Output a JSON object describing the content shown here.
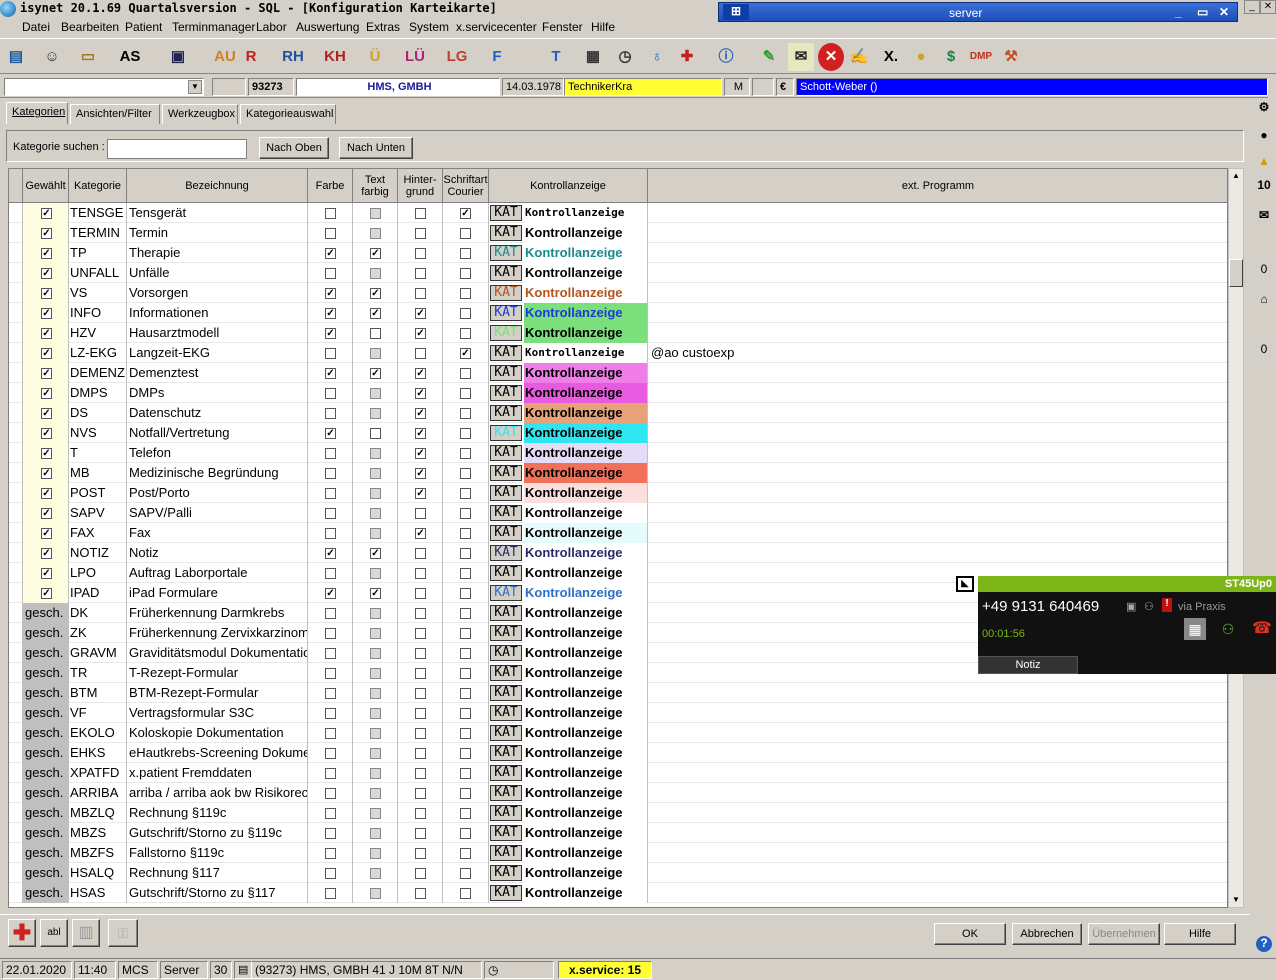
{
  "window": {
    "title": "isynet 20.1.69 Quartalsversion - SQL - [Konfiguration Karteikarte]"
  },
  "rdp": {
    "server": "server",
    "pin": "⊞",
    "min": "_",
    "restore": "▭",
    "close": "✕"
  },
  "menu": [
    "Datei",
    "Bearbeiten",
    "Patient",
    "Terminmanager",
    "Labor",
    "Auswertung",
    "Extras",
    "System",
    "x.servicecenter",
    "Fenster",
    "Hilfe"
  ],
  "toolbar": {
    "items": [
      "AS",
      "AU",
      "R",
      "RH",
      "KH",
      "Ü",
      "LÜ",
      "LG",
      "F",
      "X."
    ],
    "dmp": "DMP"
  },
  "patient": {
    "id": "93273",
    "name": "HMS, GMBH",
    "birth": "14.03.1978",
    "insurance": "TechnikerKra",
    "sex": "M",
    "currency": "€",
    "doctor": "Schott-Weber ()"
  },
  "tabs": [
    "Kategorien",
    "Ansichten/Filter",
    "Werkzeugbox",
    "Kategorieauswahl"
  ],
  "search": {
    "label": "Kategorie suchen :",
    "value": "",
    "up": "Nach Oben",
    "down": "Nach Unten"
  },
  "grid": {
    "headers": {
      "gewaehlt": "Gewählt",
      "kategorie": "Kategorie",
      "bezeichnung": "Bezeichnung",
      "farbe": "Farbe",
      "text_farbig": "Text farbig",
      "hintergrund": "Hinter- grund",
      "schriftart": "Schriftart Courier",
      "kontroll": "Kontrollanzeige",
      "ext": "ext. Programm"
    },
    "kat_label": "KAT",
    "rows": [
      {
        "sel": "check",
        "kat": "TENSGE",
        "bez": "Tensgerät",
        "f": 0,
        "t": 2,
        "h": 0,
        "s": 1,
        "katc": "#000",
        "kc": "#000",
        "kb": "#fff",
        "ctrl": "Kontrollanzeige",
        "ext": ""
      },
      {
        "sel": "check",
        "kat": "TERMIN",
        "bez": "Termin",
        "f": 0,
        "t": 2,
        "h": 0,
        "s": 0,
        "katc": "#000",
        "kc": "#000",
        "kb": "#fff",
        "ctrl": "Kontrollanzeige",
        "ext": ""
      },
      {
        "sel": "check",
        "kat": "TP",
        "bez": "Therapie",
        "f": 1,
        "t": 1,
        "h": 0,
        "s": 0,
        "katc": "#1a8a8a",
        "kc": "#1a8a8a",
        "kb": "#fff",
        "ctrl": "Kontrollanzeige",
        "ext": ""
      },
      {
        "sel": "check",
        "kat": "UNFALL",
        "bez": "Unfälle",
        "f": 0,
        "t": 2,
        "h": 0,
        "s": 0,
        "katc": "#000",
        "kc": "#000",
        "kb": "#fff",
        "ctrl": "Kontrollanzeige",
        "ext": ""
      },
      {
        "sel": "check",
        "kat": "VS",
        "bez": "Vorsorgen",
        "f": 1,
        "t": 1,
        "h": 0,
        "s": 0,
        "katc": "#b3541e",
        "kc": "#b3541e",
        "kb": "#fff",
        "ctrl": "Kontrollanzeige",
        "ext": ""
      },
      {
        "sel": "check",
        "kat": "INFO",
        "bez": "Informationen",
        "f": 1,
        "t": 1,
        "h": 1,
        "s": 0,
        "katc": "#1a3bd6",
        "kc": "#1a3bd6",
        "kb": "#7be07b",
        "ctrl": "Kontrollanzeige",
        "ext": ""
      },
      {
        "sel": "check",
        "kat": "HZV",
        "bez": "Hausarztmodell",
        "f": 1,
        "t": 0,
        "h": 1,
        "s": 0,
        "katc": "#7be07b",
        "kc": "#000",
        "kb": "#7be07b",
        "ctrl": "Kontrollanzeige",
        "ext": ""
      },
      {
        "sel": "check",
        "kat": "LZ-EKG",
        "bez": "Langzeit-EKG",
        "f": 0,
        "t": 2,
        "h": 0,
        "s": 1,
        "katc": "#000",
        "kc": "#000",
        "kb": "#fff",
        "ctrl": "Kontrollanzeige",
        "ext": "@ao custoexp"
      },
      {
        "sel": "check",
        "kat": "DEMENZ",
        "bez": "Demenztest",
        "f": 1,
        "t": 1,
        "h": 1,
        "s": 0,
        "katc": "#000",
        "kc": "#000",
        "kb": "#f07de8",
        "ctrl": "Kontrollanzeige",
        "ext": ""
      },
      {
        "sel": "check",
        "kat": "DMPS",
        "bez": "DMPs",
        "f": 0,
        "t": 2,
        "h": 1,
        "s": 0,
        "katc": "#000",
        "kc": "#000",
        "kb": "#e85ae0",
        "ctrl": "Kontrollanzeige",
        "ext": ""
      },
      {
        "sel": "check",
        "kat": "DS",
        "bez": "Datenschutz",
        "f": 0,
        "t": 2,
        "h": 1,
        "s": 0,
        "katc": "#000",
        "kc": "#000",
        "kb": "#e8a27a",
        "ctrl": "Kontrollanzeige",
        "ext": ""
      },
      {
        "sel": "check",
        "kat": "NVS",
        "bez": "Notfall/Vertretung",
        "f": 1,
        "t": 0,
        "h": 1,
        "s": 0,
        "katc": "#2ee6f0",
        "kc": "#000",
        "kb": "#2ee6f0",
        "ctrl": "Kontrollanzeige",
        "ext": ""
      },
      {
        "sel": "check",
        "kat": "T",
        "bez": "Telefon",
        "f": 0,
        "t": 2,
        "h": 1,
        "s": 0,
        "katc": "#000",
        "kc": "#000",
        "kb": "#e4dcf6",
        "ctrl": "Kontrollanzeige",
        "ext": ""
      },
      {
        "sel": "check",
        "kat": "MB",
        "bez": "Medizinische Begründung",
        "f": 0,
        "t": 2,
        "h": 1,
        "s": 0,
        "katc": "#000",
        "kc": "#000",
        "kb": "#f0705a",
        "ctrl": "Kontrollanzeige",
        "ext": ""
      },
      {
        "sel": "check",
        "kat": "POST",
        "bez": "Post/Porto",
        "f": 0,
        "t": 2,
        "h": 1,
        "s": 0,
        "katc": "#000",
        "kc": "#000",
        "kb": "#fbdede",
        "ctrl": "Kontrollanzeige",
        "ext": ""
      },
      {
        "sel": "check",
        "kat": "SAPV",
        "bez": "SAPV/Palli",
        "f": 0,
        "t": 2,
        "h": 0,
        "s": 0,
        "katc": "#000",
        "kc": "#000",
        "kb": "#fff",
        "ctrl": "Kontrollanzeige",
        "ext": ""
      },
      {
        "sel": "check",
        "kat": "FAX",
        "bez": "Fax",
        "f": 0,
        "t": 2,
        "h": 1,
        "s": 0,
        "katc": "#000",
        "kc": "#000",
        "kb": "#e6fbfb",
        "ctrl": "Kontrollanzeige",
        "ext": ""
      },
      {
        "sel": "check",
        "kat": "NOTIZ",
        "bez": "Notiz",
        "f": 1,
        "t": 1,
        "h": 0,
        "s": 0,
        "katc": "#2a2a6a",
        "kc": "#2a2a6a",
        "kb": "#fff",
        "ctrl": "Kontrollanzeige",
        "ext": ""
      },
      {
        "sel": "check",
        "kat": "LPO",
        "bez": "Auftrag Laborportale",
        "f": 0,
        "t": 2,
        "h": 0,
        "s": 0,
        "katc": "#000",
        "kc": "#000",
        "kb": "#fff",
        "ctrl": "Kontrollanzeige",
        "ext": ""
      },
      {
        "sel": "check",
        "kat": "IPAD",
        "bez": "iPad Formulare",
        "f": 1,
        "t": 1,
        "h": 0,
        "s": 0,
        "katc": "#2a70c8",
        "kc": "#2a70c8",
        "kb": "#fff",
        "ctrl": "Kontrollanzeige",
        "ext": ""
      },
      {
        "sel": "gesch.",
        "kat": "DK",
        "bez": "Früherkennung Darmkrebs",
        "f": 0,
        "t": 2,
        "h": 0,
        "s": 0,
        "katc": "#000",
        "kc": "#000",
        "kb": "#fff",
        "ctrl": "Kontrollanzeige",
        "ext": ""
      },
      {
        "sel": "gesch.",
        "kat": "ZK",
        "bez": "Früherkennung Zervixkarzinom",
        "f": 0,
        "t": 2,
        "h": 0,
        "s": 0,
        "katc": "#000",
        "kc": "#000",
        "kb": "#fff",
        "ctrl": "Kontrollanzeige",
        "ext": ""
      },
      {
        "sel": "gesch.",
        "kat": "GRAVM",
        "bez": "Graviditätsmodul Dokumentation",
        "f": 0,
        "t": 2,
        "h": 0,
        "s": 0,
        "katc": "#000",
        "kc": "#000",
        "kb": "#fff",
        "ctrl": "Kontrollanzeige",
        "ext": ""
      },
      {
        "sel": "gesch.",
        "kat": "TR",
        "bez": "T-Rezept-Formular",
        "f": 0,
        "t": 2,
        "h": 0,
        "s": 0,
        "katc": "#000",
        "kc": "#000",
        "kb": "#fff",
        "ctrl": "Kontrollanzeige",
        "ext": ""
      },
      {
        "sel": "gesch.",
        "kat": "BTM",
        "bez": "BTM-Rezept-Formular",
        "f": 0,
        "t": 2,
        "h": 0,
        "s": 0,
        "katc": "#000",
        "kc": "#000",
        "kb": "#fff",
        "ctrl": "Kontrollanzeige",
        "ext": ""
      },
      {
        "sel": "gesch.",
        "kat": "VF",
        "bez": "Vertragsformular S3C",
        "f": 0,
        "t": 2,
        "h": 0,
        "s": 0,
        "katc": "#000",
        "kc": "#000",
        "kb": "#fff",
        "ctrl": "Kontrollanzeige",
        "ext": ""
      },
      {
        "sel": "gesch.",
        "kat": "EKOLO",
        "bez": "Koloskopie Dokumentation",
        "f": 0,
        "t": 2,
        "h": 0,
        "s": 0,
        "katc": "#000",
        "kc": "#000",
        "kb": "#fff",
        "ctrl": "Kontrollanzeige",
        "ext": ""
      },
      {
        "sel": "gesch.",
        "kat": "EHKS",
        "bez": "eHautkrebs-Screening Dokumentation",
        "f": 0,
        "t": 2,
        "h": 0,
        "s": 0,
        "katc": "#000",
        "kc": "#000",
        "kb": "#fff",
        "ctrl": "Kontrollanzeige",
        "ext": ""
      },
      {
        "sel": "gesch.",
        "kat": "XPATFD",
        "bez": "x.patient Fremddaten",
        "f": 0,
        "t": 2,
        "h": 0,
        "s": 0,
        "katc": "#000",
        "kc": "#000",
        "kb": "#fff",
        "ctrl": "Kontrollanzeige",
        "ext": ""
      },
      {
        "sel": "gesch.",
        "kat": "ARRIBA",
        "bez": "arriba / arriba aok bw Risikorechner",
        "f": 0,
        "t": 2,
        "h": 0,
        "s": 0,
        "katc": "#000",
        "kc": "#000",
        "kb": "#fff",
        "ctrl": "Kontrollanzeige",
        "ext": ""
      },
      {
        "sel": "gesch.",
        "kat": "MBZLQ",
        "bez": "Rechnung §119c",
        "f": 0,
        "t": 2,
        "h": 0,
        "s": 0,
        "katc": "#000",
        "kc": "#000",
        "kb": "#fff",
        "ctrl": "Kontrollanzeige",
        "ext": ""
      },
      {
        "sel": "gesch.",
        "kat": "MBZS",
        "bez": "Gutschrift/Storno zu §119c",
        "f": 0,
        "t": 2,
        "h": 0,
        "s": 0,
        "katc": "#000",
        "kc": "#000",
        "kb": "#fff",
        "ctrl": "Kontrollanzeige",
        "ext": ""
      },
      {
        "sel": "gesch.",
        "kat": "MBZFS",
        "bez": "Fallstorno §119c",
        "f": 0,
        "t": 2,
        "h": 0,
        "s": 0,
        "katc": "#000",
        "kc": "#000",
        "kb": "#fff",
        "ctrl": "Kontrollanzeige",
        "ext": ""
      },
      {
        "sel": "gesch.",
        "kat": "HSALQ",
        "bez": "Rechnung §117",
        "f": 0,
        "t": 2,
        "h": 0,
        "s": 0,
        "katc": "#000",
        "kc": "#000",
        "kb": "#fff",
        "ctrl": "Kontrollanzeige",
        "ext": ""
      },
      {
        "sel": "gesch.",
        "kat": "HSAS",
        "bez": "Gutschrift/Storno zu §117",
        "f": 0,
        "t": 2,
        "h": 0,
        "s": 0,
        "katc": "#000",
        "kc": "#000",
        "kb": "#fff",
        "ctrl": "Kontrollanzeige",
        "ext": ""
      }
    ]
  },
  "bottom": {
    "ok": "OK",
    "cancel": "Abbrechen",
    "apply": "Übernehmen",
    "help": "Hilfe",
    "abl": "abl"
  },
  "status": {
    "date": "22.01.2020",
    "time": "11:40",
    "user": "MCS",
    "server": "Server",
    "num": "30",
    "patient": "(93273) HMS, GMBH 41 J 10M 8T N/N",
    "xservice": "x.service: 15"
  },
  "rightbar": {
    "count1": "10",
    "count2": "0",
    "count3": "0"
  },
  "phone": {
    "line": "ST45Up0",
    "number": "+49 9131 640469",
    "via": "via Praxis",
    "timer": "00:01:56",
    "note": "Notiz"
  },
  "colors": {
    "accent": "#7cb518",
    "selection_blue": "#0000ff",
    "patient_yellow": "#ffff33"
  },
  "icons": [
    "app-logo-icon",
    "pin-icon",
    "minimize-icon",
    "restore-icon",
    "close-icon",
    "error-icon",
    "dollar-icon",
    "phone-hangup-icon",
    "keypad-icon",
    "contacts-icon",
    "help-icon",
    "warning-icon",
    "user-icon",
    "mail-icon",
    "home-icon",
    "settings-icon",
    "add-icon",
    "trash-icon",
    "key-icon",
    "clock-icon",
    "document-icon"
  ]
}
